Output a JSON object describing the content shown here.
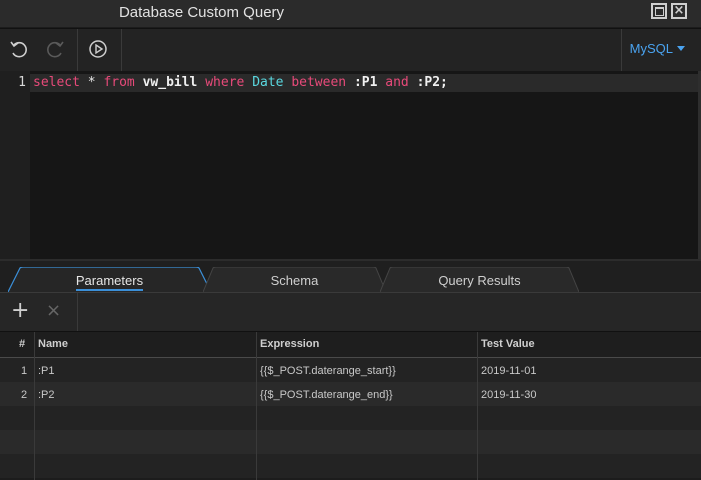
{
  "window": {
    "title": "Database Custom Query"
  },
  "toolbar": {
    "icons": [
      "undo-icon",
      "redo-icon",
      "run-icon"
    ],
    "dialect": "MySQL"
  },
  "editor": {
    "line_number": "1",
    "tokens": {
      "t1": "select",
      "t2": " * ",
      "t3": "from",
      "t4": " ",
      "t5": "vw_bill",
      "t6": " ",
      "t7": "where",
      "t8": " ",
      "t9": "Date",
      "t10": " ",
      "t11": "between",
      "t12": " ",
      "t13": ":P1",
      "t14": " ",
      "t15": "and",
      "t16": " ",
      "t17": ":P2;"
    },
    "colors": {
      "keyword": "#e84a7a",
      "column": "#5ad8e0",
      "identifier": "#f0f0f0"
    }
  },
  "tabs": [
    {
      "label": "Parameters",
      "active": true
    },
    {
      "label": "Schema",
      "active": false
    },
    {
      "label": "Query Results",
      "active": false
    }
  ],
  "params_toolbar": {
    "add": "+",
    "remove": "×"
  },
  "table": {
    "headers": [
      "#",
      "Name",
      "Expression",
      "Test Value"
    ],
    "rows": [
      {
        "num": "1",
        "name": ":P1",
        "expression": "{{$_POST.daterange_start}}",
        "test": "2019-11-01"
      },
      {
        "num": "2",
        "name": ":P2",
        "expression": "{{$_POST.daterange_end}}",
        "test": "2019-11-30"
      }
    ]
  }
}
